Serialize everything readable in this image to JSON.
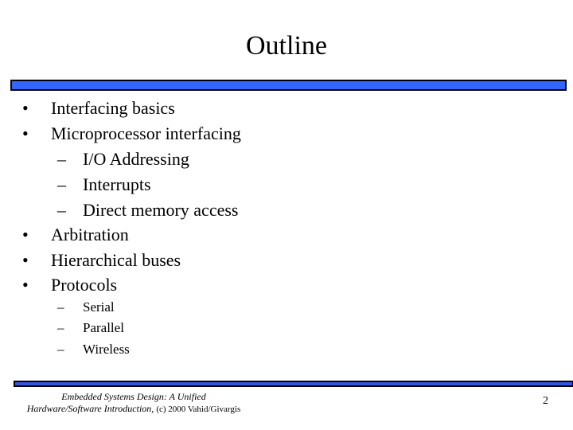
{
  "slide": {
    "title": "Outline",
    "accent_color": "#3366ff",
    "bullets": [
      {
        "marker": "•",
        "label": "Interfacing basics"
      },
      {
        "marker": "•",
        "label": "Microprocessor interfacing"
      },
      {
        "marker": "–",
        "label": "I/O Addressing"
      },
      {
        "marker": "–",
        "label": "Interrupts"
      },
      {
        "marker": "–",
        "label": "Direct memory access"
      },
      {
        "marker": "•",
        "label": "Arbitration"
      },
      {
        "marker": "•",
        "label": "Hierarchical buses"
      },
      {
        "marker": "•",
        "label": "Protocols"
      },
      {
        "marker": "–",
        "label": "Serial"
      },
      {
        "marker": "–",
        "label": "Parallel"
      },
      {
        "marker": "–",
        "label": "Wireless"
      }
    ]
  },
  "footer": {
    "line1": "Embedded Systems Design: A Unified",
    "line2_italic": "Hardware/Software Introduction,",
    "line2_copyright": "(c) 2000 Vahid/Givargis",
    "page_number": "2"
  }
}
